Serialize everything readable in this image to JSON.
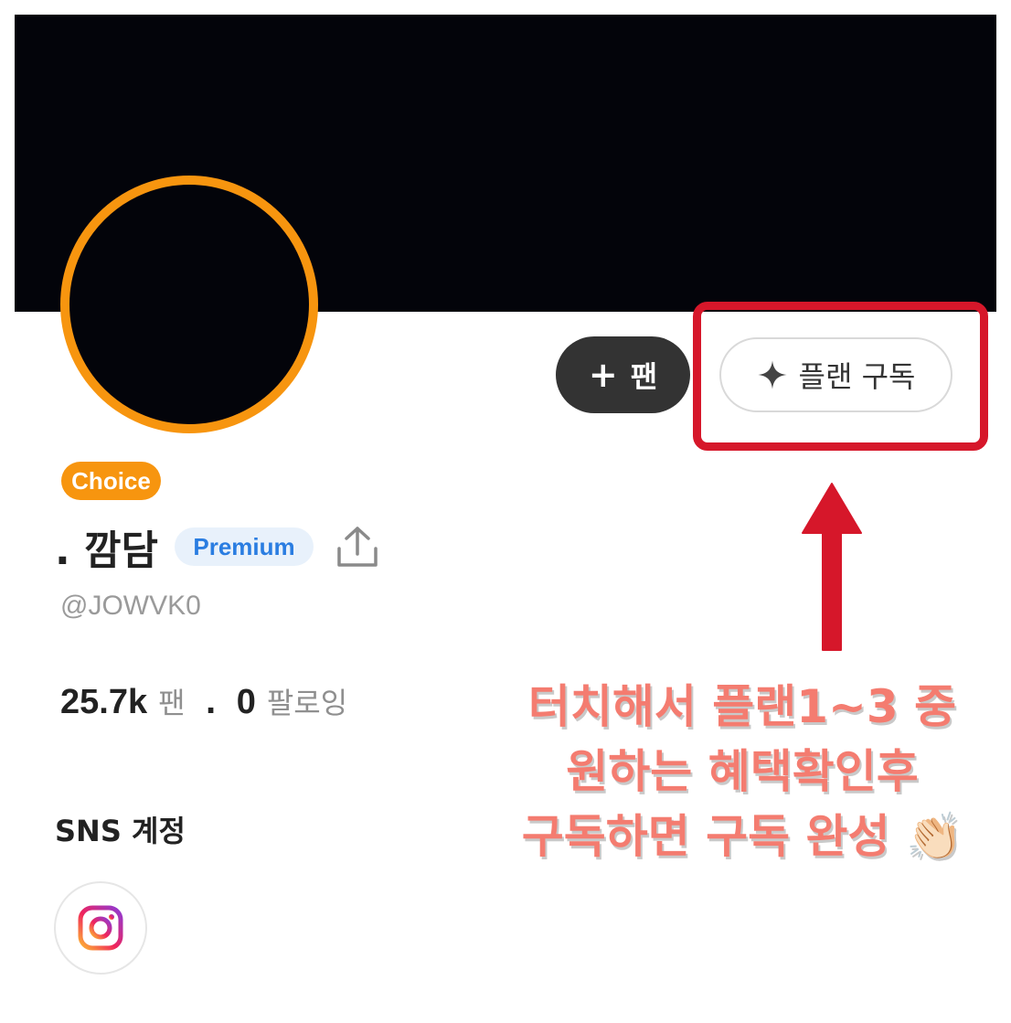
{
  "profile": {
    "badge": "Choice",
    "display_name": ". 깜담",
    "tier_badge": "Premium",
    "handle": "@JOWVK0"
  },
  "actions": {
    "fan_plus": "+",
    "fan_label": "팬",
    "plan_label": "플랜 구독"
  },
  "stats": {
    "fans_value": "25.7k",
    "fans_label": "팬",
    "separator": ".",
    "following_value": "0",
    "following_label": "팔로잉"
  },
  "sns": {
    "title": "SNS 계정",
    "links": [
      "instagram-icon"
    ]
  },
  "annotation": {
    "lines": [
      "터치해서 플랜1~3 중",
      "원하는 혜택확인후",
      "구독하면 구독 완성"
    ],
    "emoji": "👏🏻",
    "color": "#f47c70",
    "highlight_color": "#d6172a"
  },
  "colors": {
    "accent_orange": "#f7950f",
    "premium_blue": "#2a7de1",
    "cover": "#03040a"
  }
}
